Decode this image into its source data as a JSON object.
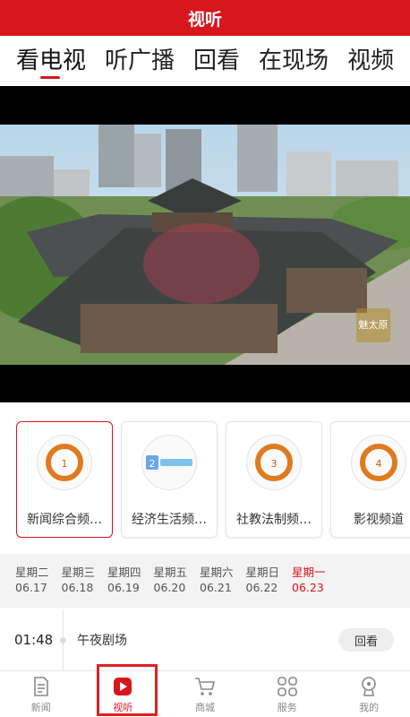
{
  "header": {
    "title": "视听"
  },
  "tabs": [
    {
      "label": "看电视",
      "active": true
    },
    {
      "label": "听广播"
    },
    {
      "label": "回看"
    },
    {
      "label": "在现场"
    },
    {
      "label": "视频"
    }
  ],
  "player": {
    "watermark": "魅太原"
  },
  "channels": [
    {
      "name": "新闻综合频…",
      "logo": "tv-logo-1",
      "active": true
    },
    {
      "name": "经济生活频…",
      "logo": "tv-logo-2"
    },
    {
      "name": "社教法制频…",
      "logo": "tv-logo-3"
    },
    {
      "name": "影视频道",
      "logo": "tv-logo-4"
    }
  ],
  "week": [
    {
      "day": "星期二",
      "date": "06.17"
    },
    {
      "day": "星期三",
      "date": "06.18"
    },
    {
      "day": "星期四",
      "date": "06.19"
    },
    {
      "day": "星期五",
      "date": "06.20"
    },
    {
      "day": "星期六",
      "date": "06.21"
    },
    {
      "day": "星期日",
      "date": "06.22"
    },
    {
      "day": "星期一",
      "date": "06.23",
      "active": true
    }
  ],
  "program": {
    "time": "01:48",
    "title": "午夜剧场",
    "action": "回看"
  },
  "nav": [
    {
      "label": "新闻",
      "icon": "news-icon"
    },
    {
      "label": "视听",
      "icon": "play-icon",
      "active": true
    },
    {
      "label": "商城",
      "icon": "cart-icon"
    },
    {
      "label": "服务",
      "icon": "grid-icon"
    },
    {
      "label": "我的",
      "icon": "profile-icon"
    }
  ],
  "colors": {
    "accent": "#d8161e"
  }
}
